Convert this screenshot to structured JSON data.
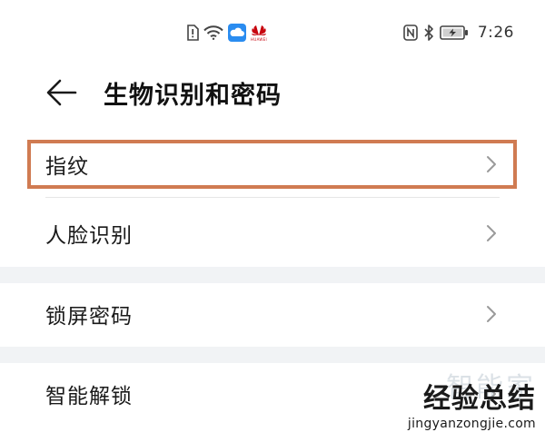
{
  "status_bar": {
    "time": "7:26",
    "brand_text": "HUAWEI",
    "icons_center": [
      "sim-alert-icon",
      "wifi-icon",
      "cloud-app-icon",
      "huawei-logo-icon"
    ],
    "icons_right": [
      "nfc-icon",
      "bluetooth-icon",
      "battery-charging-icon"
    ]
  },
  "header": {
    "title": "生物识别和密码",
    "back_icon": "arrow-left-icon"
  },
  "list": {
    "items": [
      {
        "label": "指纹",
        "highlighted": true
      },
      {
        "label": "人脸识别",
        "highlighted": false
      },
      {
        "label": "锁屏密码",
        "highlighted": false
      },
      {
        "label": "智能解锁",
        "highlighted": false
      }
    ]
  },
  "watermark": {
    "top": "智能家",
    "main": "经验总结",
    "url": "jingyanzongjie.com"
  },
  "colors": {
    "highlight_border": "#d07b52",
    "section_gap": "#f1f3f5",
    "huawei_red": "#c7000b",
    "cloud_blue": "#2a8cf0"
  }
}
